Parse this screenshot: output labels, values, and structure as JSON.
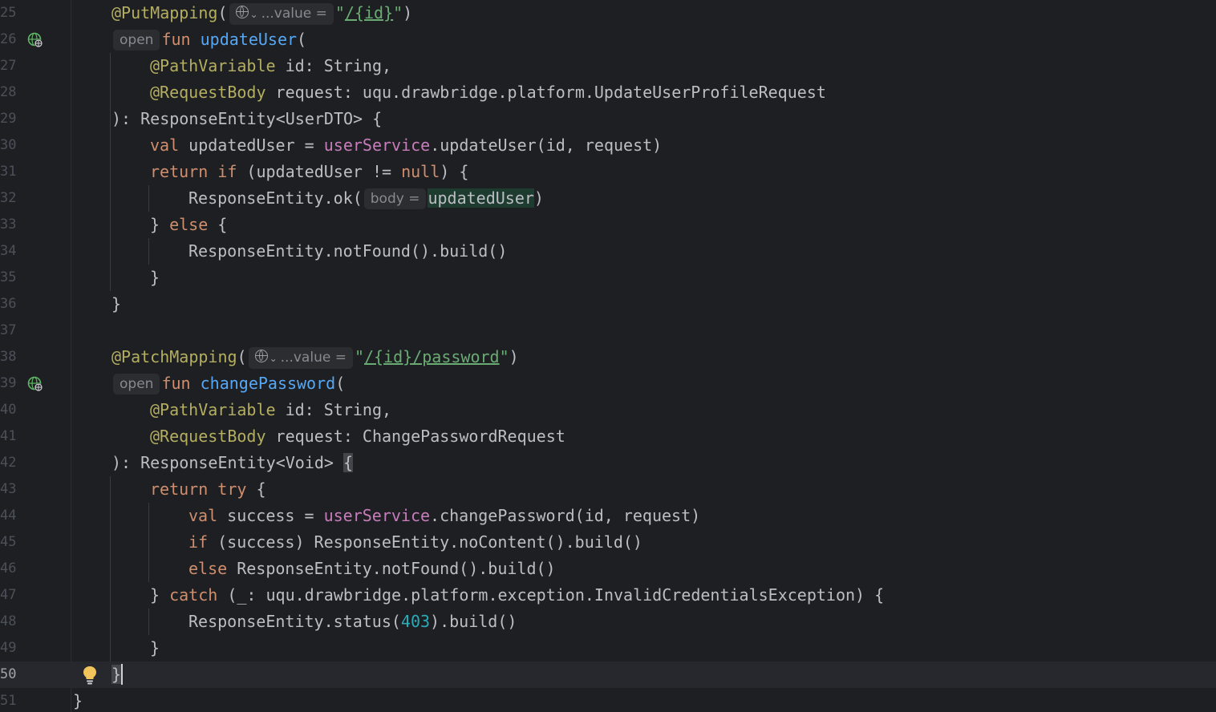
{
  "editor": {
    "line_numbers": [
      "25",
      "26",
      "27",
      "28",
      "29",
      "30",
      "31",
      "32",
      "33",
      "34",
      "35",
      "36",
      "37",
      "38",
      "39",
      "40",
      "41",
      "42",
      "43",
      "44",
      "45",
      "46",
      "47",
      "48",
      "49",
      "50",
      "51"
    ],
    "current_line": "50"
  },
  "code": {
    "l25": {
      "ann": "@PutMapping",
      "open_paren": "(",
      "hint": "...value =",
      "q1": "\"",
      "url": "/{id}",
      "q2": "\"",
      "close": ")"
    },
    "l26": {
      "hint": "open",
      "kw": "fun ",
      "fn": "updateUser",
      "rest": "("
    },
    "l27": {
      "ann": "@PathVariable",
      "rest": " id: String,"
    },
    "l28": {
      "ann": "@RequestBody",
      "rest": " request: uqu.drawbridge.platform.UpdateUserProfileRequest"
    },
    "l29": {
      "rest": "): ResponseEntity<UserDTO> {"
    },
    "l30": {
      "kw": "val",
      "mid": " updatedUser = ",
      "field": "userService",
      "rest": ".updateUser(id, request)"
    },
    "l31": {
      "kw1": "return",
      "sp": " ",
      "kw2": "if",
      "mid": " (updatedUser != ",
      "kw3": "null",
      "rest": ") {"
    },
    "l32": {
      "pre": "ResponseEntity.ok(",
      "hint": "body =",
      "ident": "updatedUser",
      "rest": ")"
    },
    "l33": {
      "pre": "} ",
      "kw": "else",
      "rest": " {"
    },
    "l34": {
      "rest": "ResponseEntity.notFound().build()"
    },
    "l35": {
      "rest": "}"
    },
    "l36": {
      "rest": "}"
    },
    "l38": {
      "ann": "@PatchMapping",
      "open_paren": "(",
      "hint": "...value =",
      "q1": "\"",
      "url": "/{id}/password",
      "q2": "\"",
      "close": ")"
    },
    "l39": {
      "hint": "open",
      "kw": "fun ",
      "fn": "changePassword",
      "rest": "("
    },
    "l40": {
      "ann": "@PathVariable",
      "rest": " id: String,"
    },
    "l41": {
      "ann": "@RequestBody",
      "rest": " request: ChangePasswordRequest"
    },
    "l42": {
      "rest": "): ResponseEntity<Void> ",
      "brace": "{"
    },
    "l43": {
      "kw1": "return",
      "sp": " ",
      "kw2": "try",
      "rest": " {"
    },
    "l44": {
      "kw": "val",
      "mid": " success = ",
      "field": "userService",
      "rest": ".changePassword(id, request)"
    },
    "l45": {
      "kw": "if",
      "rest": " (success) ResponseEntity.noContent().build()"
    },
    "l46": {
      "kw": "else",
      "rest": " ResponseEntity.notFound().build()"
    },
    "l47": {
      "pre": "} ",
      "kw": "catch",
      "rest": " (_: uqu.drawbridge.platform.exception.InvalidCredentialsException) {"
    },
    "l48": {
      "pre": "ResponseEntity.status(",
      "num": "403",
      "rest": ").build()"
    },
    "l49": {
      "rest": "}"
    },
    "l50": {
      "brace": "}"
    },
    "l51": {
      "rest": "}"
    }
  },
  "colors": {
    "background": "#1e1f22",
    "annotation": "#b3ae60",
    "keyword": "#cf8e6d",
    "function": "#56a8f5",
    "string": "#6aab73",
    "field": "#c77dbb",
    "number": "#2aacb8"
  },
  "icons": {
    "gutter_26": "endpoint-globe-icon",
    "gutter_39": "endpoint-globe-icon",
    "line_50": "lightbulb-icon"
  }
}
